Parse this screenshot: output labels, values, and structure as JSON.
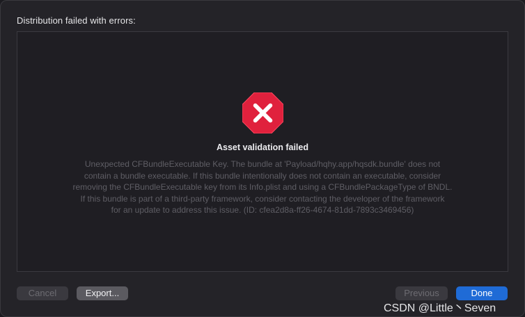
{
  "dialog": {
    "title": "Distribution failed with errors:"
  },
  "error": {
    "icon": "error-x-octagon-icon",
    "icon_color": "#e0213d",
    "title": "Asset validation failed",
    "detail_lines": [
      "Unexpected CFBundleExecutable Key. The bundle at 'Payload/hqhy.app/hqsdk.bundle' does not",
      "contain a bundle executable. If this bundle intentionally does not contain an executable, consider",
      "removing the CFBundleExecutable key from its Info.plist and using a CFBundlePackageType of BNDL.",
      "If this bundle is part of a third-party framework, consider contacting the developer of the framework",
      "for an update to address this issue. (ID: cfea2d8a-ff26-4674-81dd-7893c3469456)"
    ]
  },
  "buttons": {
    "cancel": "Cancel",
    "export": "Export...",
    "previous": "Previous",
    "done": "Done"
  },
  "colors": {
    "accent": "#1f6bd6",
    "background": "#242328"
  },
  "watermark": "CSDN @Little丶Seven"
}
